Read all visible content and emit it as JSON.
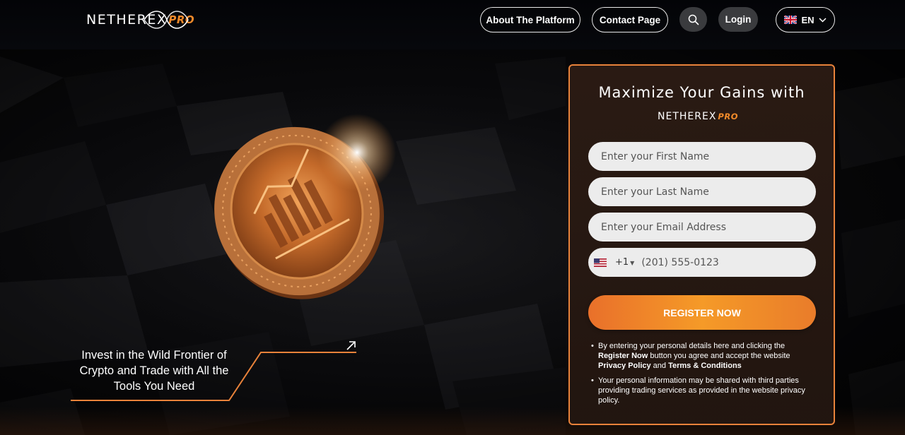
{
  "header": {
    "logo_main": "NETHEREX",
    "logo_pro": "PRO",
    "nav": {
      "about": "About The Platform",
      "contact": "Contact Page",
      "login": "Login",
      "language": "EN"
    }
  },
  "hero": {
    "tagline": "Invest in the Wild Frontier of Crypto and Trade with All the Tools You Need"
  },
  "form": {
    "heading": "Maximize Your Gains with",
    "logo_main": "NETHEREX",
    "logo_pro": "PRO",
    "first_name_placeholder": "Enter your First Name",
    "last_name_placeholder": "Enter your Last Name",
    "email_placeholder": "Enter your Email Address",
    "phone_dial_code": "+1",
    "phone_placeholder": "(201) 555-0123",
    "register_label": "REGISTER NOW",
    "disclaimer_1": {
      "prefix": "By entering your personal details here and clicking the",
      "register_now": "Register Now",
      "middle": "button you agree and accept the website",
      "privacy": "Privacy Policy",
      "and": "and",
      "terms": "Terms & Conditions"
    },
    "disclaimer_2": "Your personal information may be shared with third parties providing trading services as provided in the website privacy policy."
  },
  "colors": {
    "accent": "#f08a2a",
    "card_border": "#e8823a",
    "background": "#0b0b0e"
  },
  "icons": {
    "search": "search-icon",
    "chevron": "chevron-down-icon",
    "uk_flag": "uk-flag-icon",
    "us_flag": "us-flag-icon",
    "arrow": "arrow-up-right-icon",
    "coin": "coin-image"
  }
}
